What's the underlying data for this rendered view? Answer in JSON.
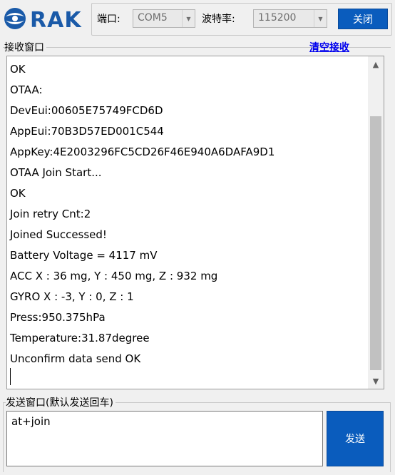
{
  "logo": {
    "text": "RAK"
  },
  "toolbar": {
    "port_label": "端口:",
    "port_value": "COM5",
    "baud_label": "波特率:",
    "baud_value": "115200",
    "close_label": "关闭"
  },
  "receive": {
    "legend": "接收窗口",
    "clear_label": "清空接收",
    "lines": [
      "OK",
      "OTAA:",
      "DevEui:00605E75749FCD6D",
      "AppEui:70B3D57ED001C544",
      "AppKey:4E2003296FC5CD26F46E940A6DAFA9D1",
      "OTAA Join Start...",
      "OK",
      "Join retry Cnt:2",
      "Joined Successed!",
      "Battery Voltage = 4117 mV",
      "ACC X : 36 mg, Y : 450 mg, Z : 932 mg",
      "GYRO X : -3, Y : 0, Z : 1",
      "Press:950.375hPa",
      "Temperature:31.87degree",
      "Unconfirm data send OK"
    ]
  },
  "send": {
    "legend": "发送窗口(默认发送回车)",
    "value": "at+join",
    "send_label": "发送"
  },
  "icons": {
    "logo": "rak-logo-icon",
    "dropdown": "chevron-down-icon",
    "scroll_up": "scroll-up-arrow-icon",
    "scroll_down": "scroll-down-arrow-icon"
  },
  "colors": {
    "accent": "#0a5cbd",
    "brand": "#1a5aa8",
    "link": "#0000ee"
  }
}
